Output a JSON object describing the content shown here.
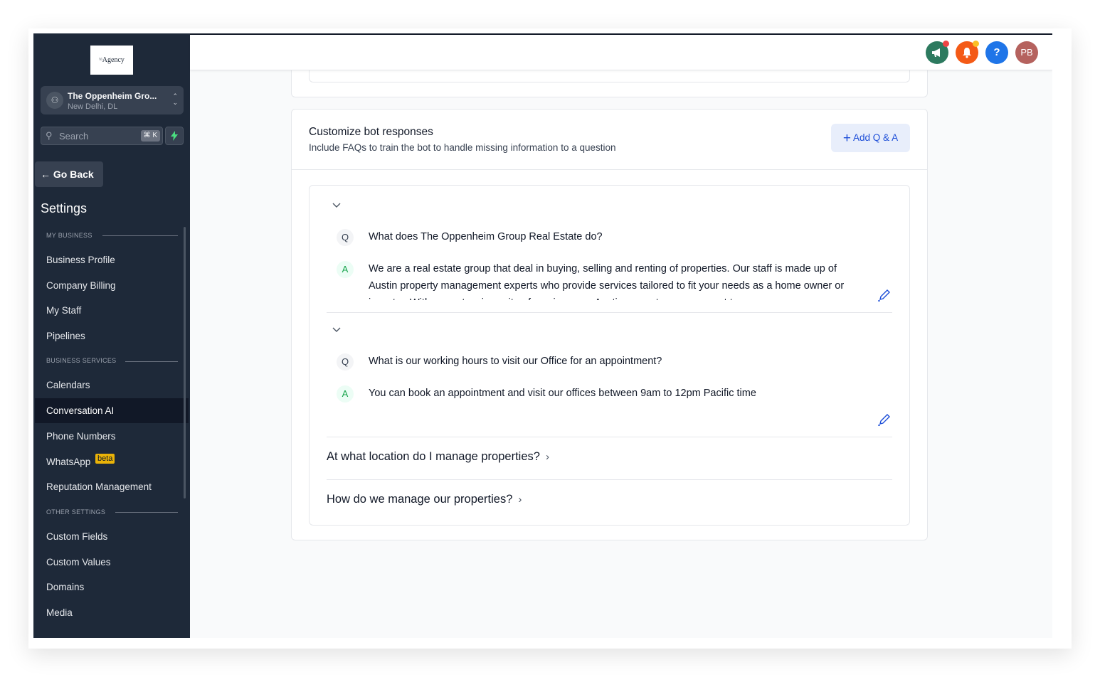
{
  "sidebar": {
    "logo_text": "Agency",
    "location": {
      "name": "The Oppenheim Gro...",
      "sub": "New Delhi, DL"
    },
    "search": {
      "placeholder": "Search",
      "shortcut": "⌘ K"
    },
    "go_back": "Go Back",
    "title": "Settings",
    "sections": {
      "my_business": "MY BUSINESS",
      "business_services": "BUSINESS SERVICES",
      "other_settings": "OTHER SETTINGS"
    },
    "items": [
      {
        "label": "Business Profile"
      },
      {
        "label": "Company Billing"
      },
      {
        "label": "My Staff"
      },
      {
        "label": "Pipelines"
      },
      {
        "label": "Calendars"
      },
      {
        "label": "Conversation AI",
        "active": true
      },
      {
        "label": "Phone Numbers"
      },
      {
        "label": "WhatsApp",
        "badge": "beta"
      },
      {
        "label": "Reputation Management"
      },
      {
        "label": "Custom Fields"
      },
      {
        "label": "Custom Values"
      },
      {
        "label": "Domains"
      },
      {
        "label": "Media"
      }
    ]
  },
  "header": {
    "avatar_initials": "PB",
    "help_icon_text": "?",
    "colors": {
      "announce": "#2d7a5f",
      "notify": "#f45a16",
      "help": "#1f75e8",
      "avatar": "#b5625e"
    }
  },
  "bot_responses": {
    "title": "Customize bot responses",
    "subtitle": "Include FAQs to train the bot to handle missing information to a question",
    "add_button": "Add Q & A",
    "q_badge": "Q",
    "a_badge": "A",
    "faqs": [
      {
        "question": "What does The Oppenheim Group Real Estate do?",
        "answer": "We are a real estate group that deal in buying, selling and renting of properties. Our staff is made up of Austin property management experts who provide services tailored to fit your needs as a home owner or investor. With our extensive suite of services, our Austin property management team"
      },
      {
        "question": "What is our working hours to visit our Office for an appointment?",
        "answer": "You can book an appointment and visit our offices between 9am to 12pm Pacific time"
      }
    ],
    "collapsed": [
      "At what location do I manage properties?",
      "How do we manage our properties?"
    ]
  }
}
